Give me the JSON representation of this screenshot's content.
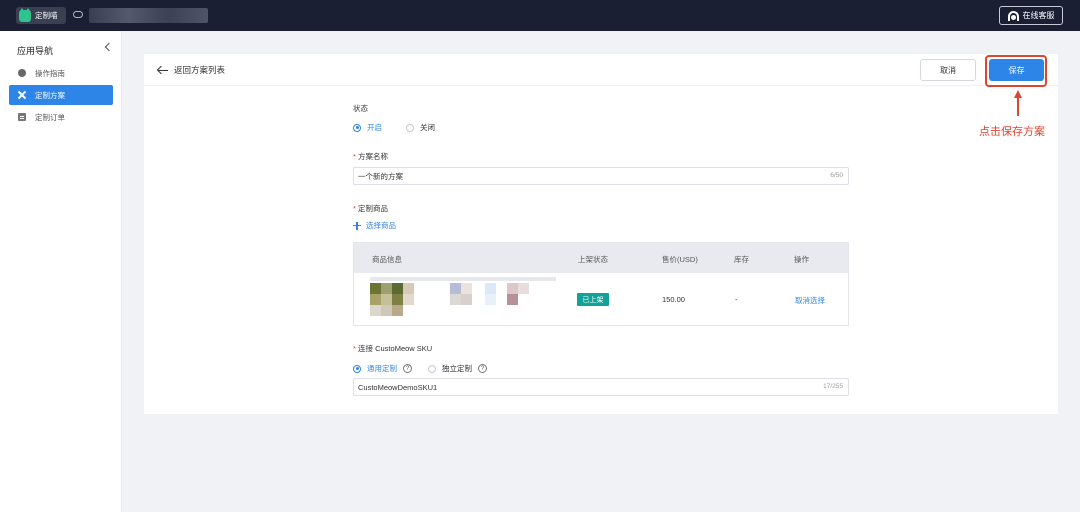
{
  "topbar": {
    "brand": "定制喵",
    "support_label": "在线客服"
  },
  "sidebar": {
    "title": "应用导航",
    "items": [
      {
        "label": "操作指南",
        "icon": "compass-icon",
        "active": false
      },
      {
        "label": "定制方案",
        "icon": "wrench-icon",
        "active": true
      },
      {
        "label": "定制订单",
        "icon": "order-icon",
        "active": false
      }
    ]
  },
  "page": {
    "back_label": "返回方案列表",
    "cancel_label": "取消",
    "save_label": "保存"
  },
  "form": {
    "status_label": "状态",
    "status_on": "开启",
    "status_off": "关闭",
    "name_label": "方案名称",
    "name_value": "一个新的方案",
    "name_counter": "6/50",
    "product_label": "定制商品",
    "select_product": "选择商品",
    "sku_label": "连接 CustoMeow SKU",
    "sku_option_generic": "通用定制",
    "sku_option_independent": "独立定制",
    "sku_value": "CustoMeowDemoSKU1",
    "sku_counter": "17/255"
  },
  "table": {
    "headers": [
      "商品信息",
      "上架状态",
      "售价(USD)",
      "库存",
      "操作"
    ],
    "rows": [
      {
        "status": "已上架",
        "price": "150.00",
        "stock": "-",
        "action": "取消选择"
      }
    ]
  },
  "annotation": {
    "text": "点击保存方案",
    "color": "#e0432e"
  },
  "colors": {
    "accent": "#2e85e8",
    "topbar": "#1b1f33",
    "badge": "#11a39a"
  }
}
